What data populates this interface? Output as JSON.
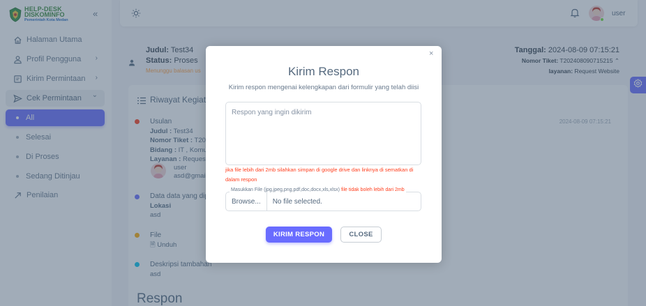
{
  "brand": {
    "line1": "HELP-DESK",
    "line2": "DISKOMINFO",
    "line3": "Pemerintah Kota Medan",
    "collapse": "«"
  },
  "sidebar": {
    "items": [
      {
        "label": "Halaman Utama",
        "icon": "home-icon"
      },
      {
        "label": "Profil Pengguna",
        "icon": "user-icon",
        "chevron": "›"
      },
      {
        "label": "Kirim Permintaan",
        "icon": "form-icon",
        "chevron": "›"
      },
      {
        "label": "Cek Permintaan",
        "icon": "send-icon",
        "chevron": "⌄"
      }
    ],
    "subitems": [
      {
        "label": "All",
        "active": true
      },
      {
        "label": "Selesai"
      },
      {
        "label": "Di Proses"
      },
      {
        "label": "Sedang Ditinjau"
      }
    ],
    "penilaian": {
      "label": "Penilaian",
      "icon": "rating-icon"
    }
  },
  "navbar": {
    "user_name": "user"
  },
  "header": {
    "judul_label": "Judul:",
    "judul_value": " Test34",
    "status_label": "Status:",
    "status_value": " Proses",
    "waiting_text": "Menunggu balasan us",
    "tanggal_label": "Tanggal:",
    "tanggal_value": " 2024-08-09 07:15:21",
    "tiket_label": "Nomor Tiket:",
    "tiket_value": " T202408090715215",
    "layanan_label": "layanan:",
    "layanan_value": " Request Website"
  },
  "riwayat": {
    "title": "Riwayat Kegiata",
    "date": "2024-08-09 07:15:21",
    "usulan": {
      "title": "Usulan",
      "judul_label": "Judul :",
      "judul_value": " Test34",
      "tiket_label": "Nomor Tiket :",
      "tiket_value": " T20",
      "bidang_label": "Bidang :",
      "bidang_value": " IT , Komu",
      "layanan_label": "Layanan :",
      "layanan_value": " Request",
      "user_name": "user",
      "user_email": "asd@gmai"
    },
    "data_dip": {
      "title": "Data data yang dip",
      "lokasi_label": "Lokasi",
      "lokasi_value": "asd"
    },
    "file": {
      "title": "File",
      "unduh": "Unduh"
    },
    "deskripsi": {
      "title": "Deskripsi tambahan",
      "value": "asd"
    },
    "respon_heading": "Respon"
  },
  "modal": {
    "close": "×",
    "title": "Kirim Respon",
    "subtitle": "Kirim respon mengenai kelengkapan dari formulir yang telah diisi",
    "textarea_placeholder": "Respon yang ingin dikirim",
    "warning": "jika file lebih dari 2mb silahkan simpan di google drive dan linknya di sematkan di dalam respon",
    "file_label": "Masukkan File (jpg,jpeg,png,pdf,doc,docx,xls,xlsx)",
    "file_label_red": " file tidak boleh lebih dari 2mb",
    "browse": "Browse...",
    "no_file": "No file selected.",
    "submit": "KIRIM RESPON",
    "cancel": "CLOSE"
  },
  "colors": {
    "primary": "#696cff",
    "danger": "#ff3e1d",
    "warning": "#ff9f43",
    "success": "#71dd37",
    "info": "#03c3ec"
  }
}
